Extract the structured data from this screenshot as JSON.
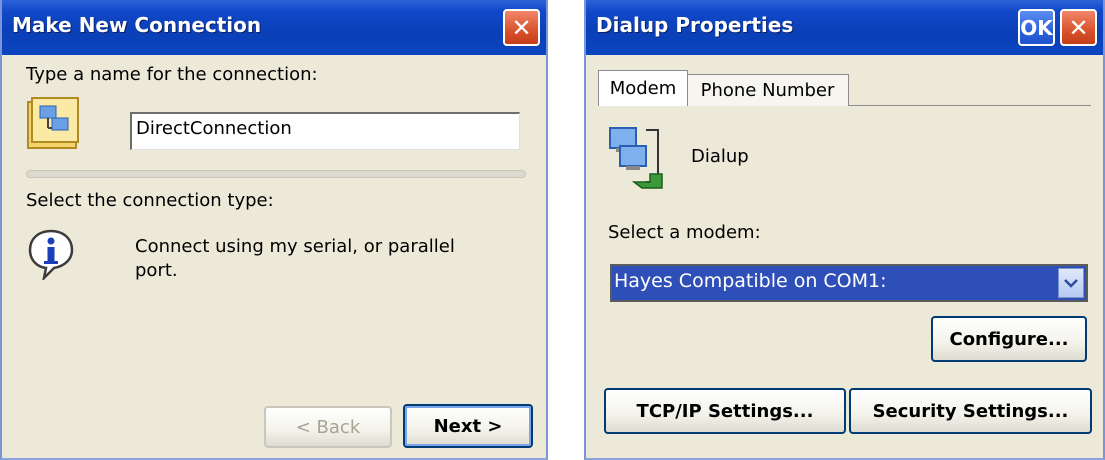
{
  "make_new_connection": {
    "title": "Make New Connection",
    "close_glyph": "✕",
    "name_prompt": "Type a name for the connection:",
    "name_value": "DirectConnection",
    "type_prompt": "Select the connection type:",
    "info_text_line1": "Connect using my serial, or parallel",
    "info_text_line2": "port.",
    "back_button": "< Back",
    "next_button": "Next >"
  },
  "dialup_properties": {
    "title": "Dialup Properties",
    "ok_label": "OK",
    "close_glyph": "✕",
    "tabs": [
      {
        "label": "Modem",
        "active": true
      },
      {
        "label": "Phone Number",
        "active": false
      }
    ],
    "connection_name": "Dialup",
    "modem_prompt": "Select a modem:",
    "modem_selected": "Hayes Compatible on COM1:",
    "configure_button": "Configure...",
    "tcpip_button": "TCP/IP Settings...",
    "security_button": "Security Settings..."
  }
}
